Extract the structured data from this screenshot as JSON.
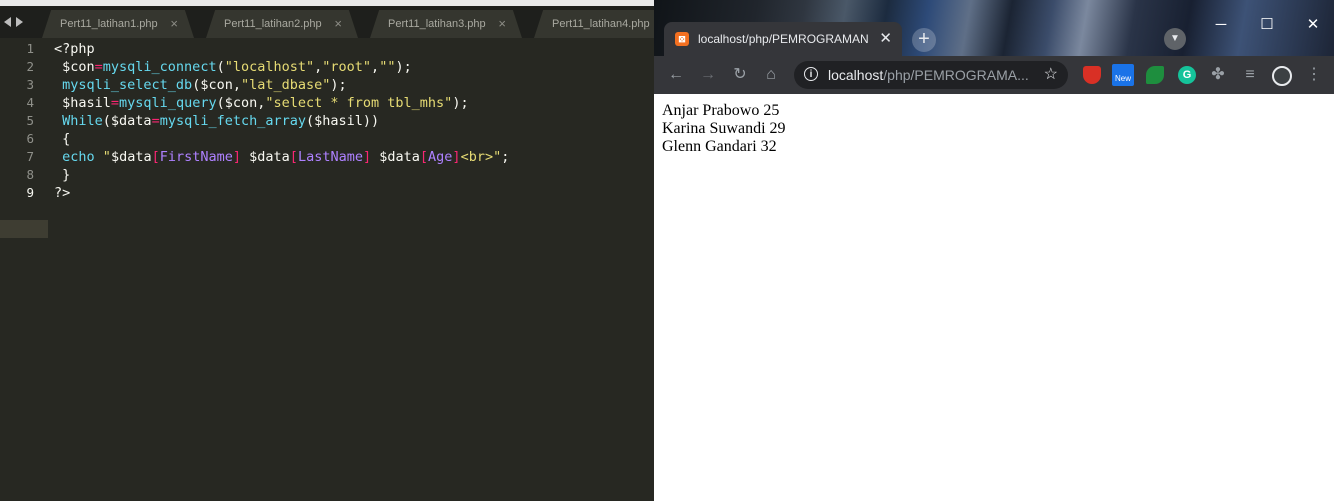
{
  "editor": {
    "tabs": [
      {
        "label": "Pert11_latihan1.php"
      },
      {
        "label": "Pert11_latihan2.php"
      },
      {
        "label": "Pert11_latihan3.php"
      },
      {
        "label": "Pert11_latihan4.php"
      }
    ],
    "line_numbers": [
      "1",
      "2",
      "3",
      "4",
      "5",
      "6",
      "7",
      "8",
      "9"
    ],
    "code_lines": [
      "<?php",
      " $con=mysqli_connect(\"localhost\",\"root\",\"\");",
      " mysqli_select_db($con,\"lat_dbase\");",
      " $hasil=mysqli_query($con,\"select * from tbl_mhs\");",
      " While($data=mysqli_fetch_array($hasil))",
      " {",
      " echo \"$data[FirstName] $data[LastName] $data[Age]<br>\";",
      " }",
      "?>"
    ],
    "close_glyph": "×"
  },
  "browser": {
    "tab_title": "localhost/php/PEMROGRAMAN W",
    "tab_favicon": "xampp-icon",
    "url_host": "localhost",
    "url_path": "/php/PEMROGRAMA...",
    "new_badge": "New",
    "output_lines": [
      "Anjar Prabowo 25",
      "Karina Suwandi 29",
      "Glenn Gandari 32"
    ]
  },
  "colors": {
    "editor_bg": "#272822",
    "keyword": "#66d9ef",
    "operator": "#f92672",
    "string": "#e6db74",
    "key": "#ae81ff",
    "chrome_toolbar": "#35363a"
  }
}
